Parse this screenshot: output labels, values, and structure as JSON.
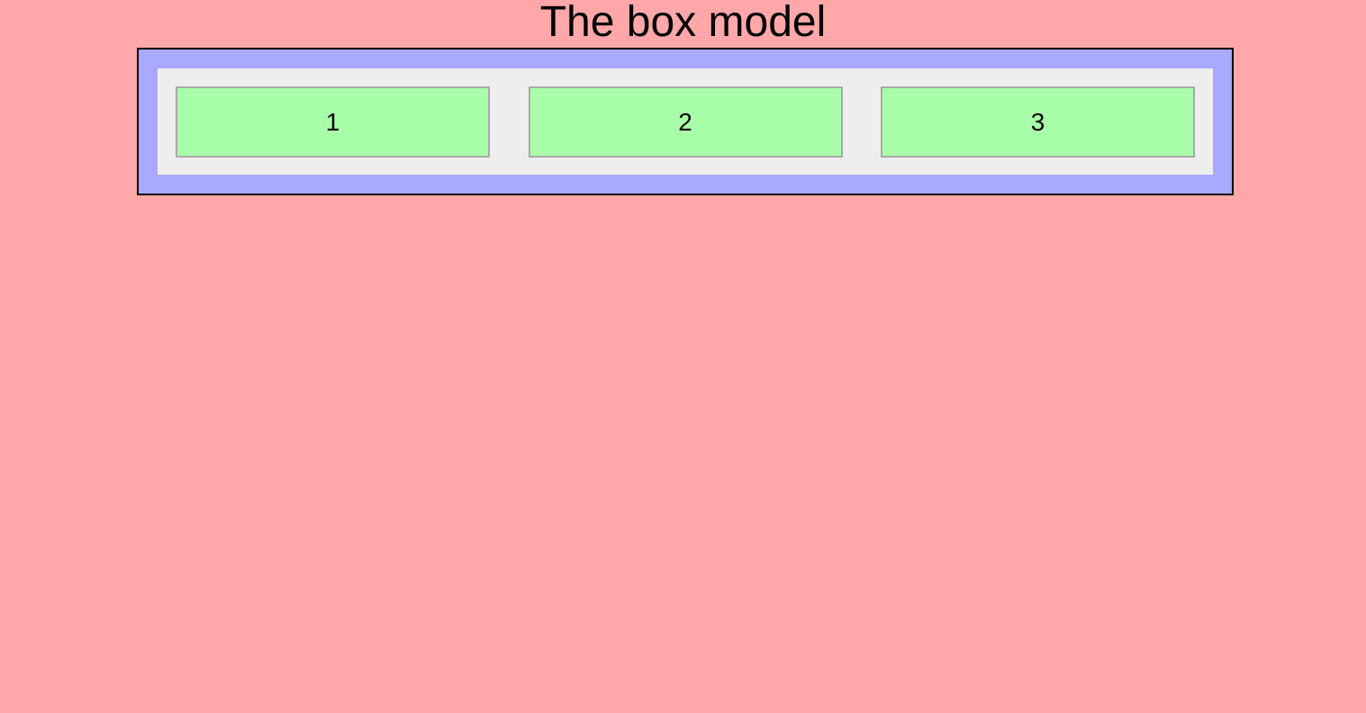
{
  "title": "The box model",
  "colors": {
    "page_background": "#ffa7a9",
    "outer_box_background": "#a9a9ff",
    "outer_box_border": "#000000",
    "inner_box_background": "#eeeeee",
    "child_box_background": "#a9ffa9",
    "child_box_border": "#a9a9a9"
  },
  "boxes": [
    {
      "label": "1"
    },
    {
      "label": "2"
    },
    {
      "label": "3"
    }
  ]
}
